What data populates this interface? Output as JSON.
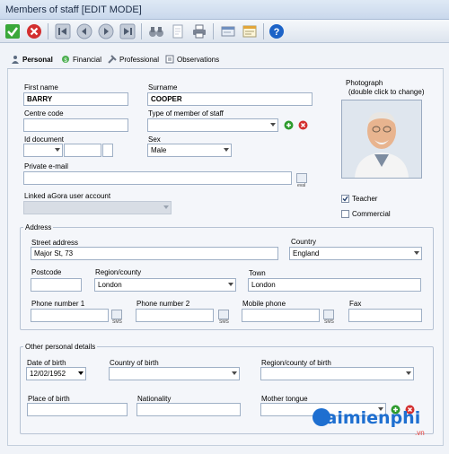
{
  "window": {
    "title": "Members of staff [EDIT MODE]"
  },
  "toolbar": {
    "buttons": [
      "check-icon",
      "cancel-icon",
      "first-icon",
      "previous-icon",
      "next-icon",
      "last-icon",
      "binoculars-icon",
      "document-icon",
      "print-icon",
      "card-icon",
      "notes-icon",
      "help-icon"
    ]
  },
  "tabs": [
    {
      "label": "Personal",
      "icon": "person-icon",
      "active": true
    },
    {
      "label": "Financial",
      "icon": "money-icon",
      "active": false
    },
    {
      "label": "Professional",
      "icon": "tools-icon",
      "active": false
    },
    {
      "label": "Observations",
      "icon": "notepad-icon",
      "active": false
    }
  ],
  "personal": {
    "first_name_label": "First name",
    "first_name": "BARRY",
    "surname_label": "Surname",
    "surname": "COOPER",
    "centre_code_label": "Centre code",
    "centre_code": "",
    "member_type_label": "Type of member of staff",
    "member_type": "",
    "id_document_label": "Id document",
    "sex_label": "Sex",
    "sex": "Male",
    "private_email_label": "Private e-mail",
    "private_email": "",
    "email_icon_caption": "eval",
    "linked_account_label": "Linked aGora user account",
    "linked_account": ""
  },
  "photo": {
    "title": "Photograph",
    "subtitle": "(double click to change)"
  },
  "roles": {
    "teacher_label": "Teacher",
    "teacher_checked": true,
    "commercial_label": "Commercial",
    "commercial_checked": false
  },
  "address": {
    "group_title": "Address",
    "street_label": "Street address",
    "street": "Major St, 73",
    "country_label": "Country",
    "country": "England",
    "postcode_label": "Postcode",
    "postcode": "",
    "region_label": "Region/county",
    "region": "London",
    "town_label": "Town",
    "town": "London",
    "phone1_label": "Phone number 1",
    "phone1": "",
    "phone2_label": "Phone number 2",
    "phone2": "",
    "mobile_label": "Mobile phone",
    "mobile": "",
    "fax_label": "Fax",
    "fax": "",
    "sms_caption": "SMS"
  },
  "other": {
    "group_title": "Other personal details",
    "dob_label": "Date of birth",
    "dob": "12/02/1952",
    "country_birth_label": "Country of birth",
    "country_birth": "",
    "region_birth_label": "Region/county of birth",
    "region_birth": "",
    "place_birth_label": "Place of birth",
    "place_birth": "",
    "nationality_label": "Nationality",
    "nationality": "",
    "mother_tongue_label": "Mother tongue",
    "mother_tongue": ""
  },
  "watermark": {
    "text": "Taimienphi",
    "suffix": ".vn"
  },
  "colors": {
    "accent": "#1e6fd0",
    "ok": "#2e9b2e",
    "cancel": "#d32f2f",
    "help": "#1c63c7"
  }
}
